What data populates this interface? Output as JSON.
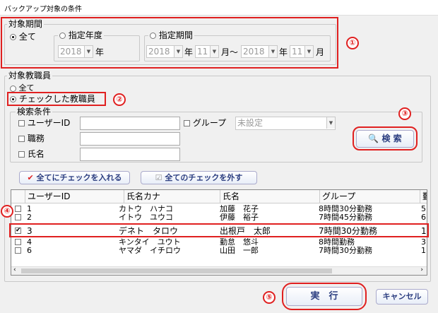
{
  "window": {
    "title": "バックアップ対象の条件"
  },
  "period": {
    "legend": "対象期間",
    "opt_all": "全て",
    "opt_year": "指定年度",
    "year_value": "2018",
    "year_unit": "年",
    "opt_range": "指定期間",
    "from_year": "2018",
    "from_month": "11",
    "to_year": "2018",
    "to_month": "11",
    "unit_year": "年",
    "unit_month": "月",
    "tilde": "〜"
  },
  "staff": {
    "legend": "対象教職員",
    "opt_all": "全て",
    "opt_checked": "チェックした教職員"
  },
  "search": {
    "legend": "検索条件",
    "user_id_label": "ユーザーID",
    "group_label": "グループ",
    "group_value": "未設定",
    "position_label": "職務",
    "name_label": "氏名",
    "search_button": "検 索"
  },
  "buttons": {
    "check_all": "全てにチェックを入れる",
    "uncheck_all": "全てのチェックを外す",
    "execute": "実　行",
    "cancel": "キャンセル"
  },
  "table": {
    "columns": [
      "ユーザーID",
      "氏名カナ",
      "氏名",
      "グループ",
      "勤"
    ],
    "rows": [
      {
        "checked": false,
        "id": "1",
        "kana": "カトウ　ハナコ",
        "name": "加藤　花子",
        "group": "8時間30分勤務",
        "extra": "5"
      },
      {
        "checked": false,
        "id": "2",
        "kana": "イトウ　ユウコ",
        "name": "伊藤　裕子",
        "group": "7時間45分勤務",
        "extra": "6"
      },
      {
        "checked": true,
        "id": "3",
        "kana": "デネト　タロウ",
        "name": "出根戸　太郎",
        "group": "7時間30分勤務",
        "extra": "1"
      },
      {
        "checked": false,
        "id": "4",
        "kana": "キンタイ　ユウト",
        "name": "勤怠　悠斗",
        "group": "8時間勤務",
        "extra": "3"
      },
      {
        "checked": false,
        "id": "6",
        "kana": "ヤマダ　イチロウ",
        "name": "山田　一郎",
        "group": "7時間30分勤務",
        "extra": "1"
      }
    ]
  },
  "badges": [
    "①",
    "②",
    "③",
    "④",
    "⑤"
  ],
  "colors": {
    "annotation_red": "#e02020",
    "button_text": "#2c3e80"
  }
}
